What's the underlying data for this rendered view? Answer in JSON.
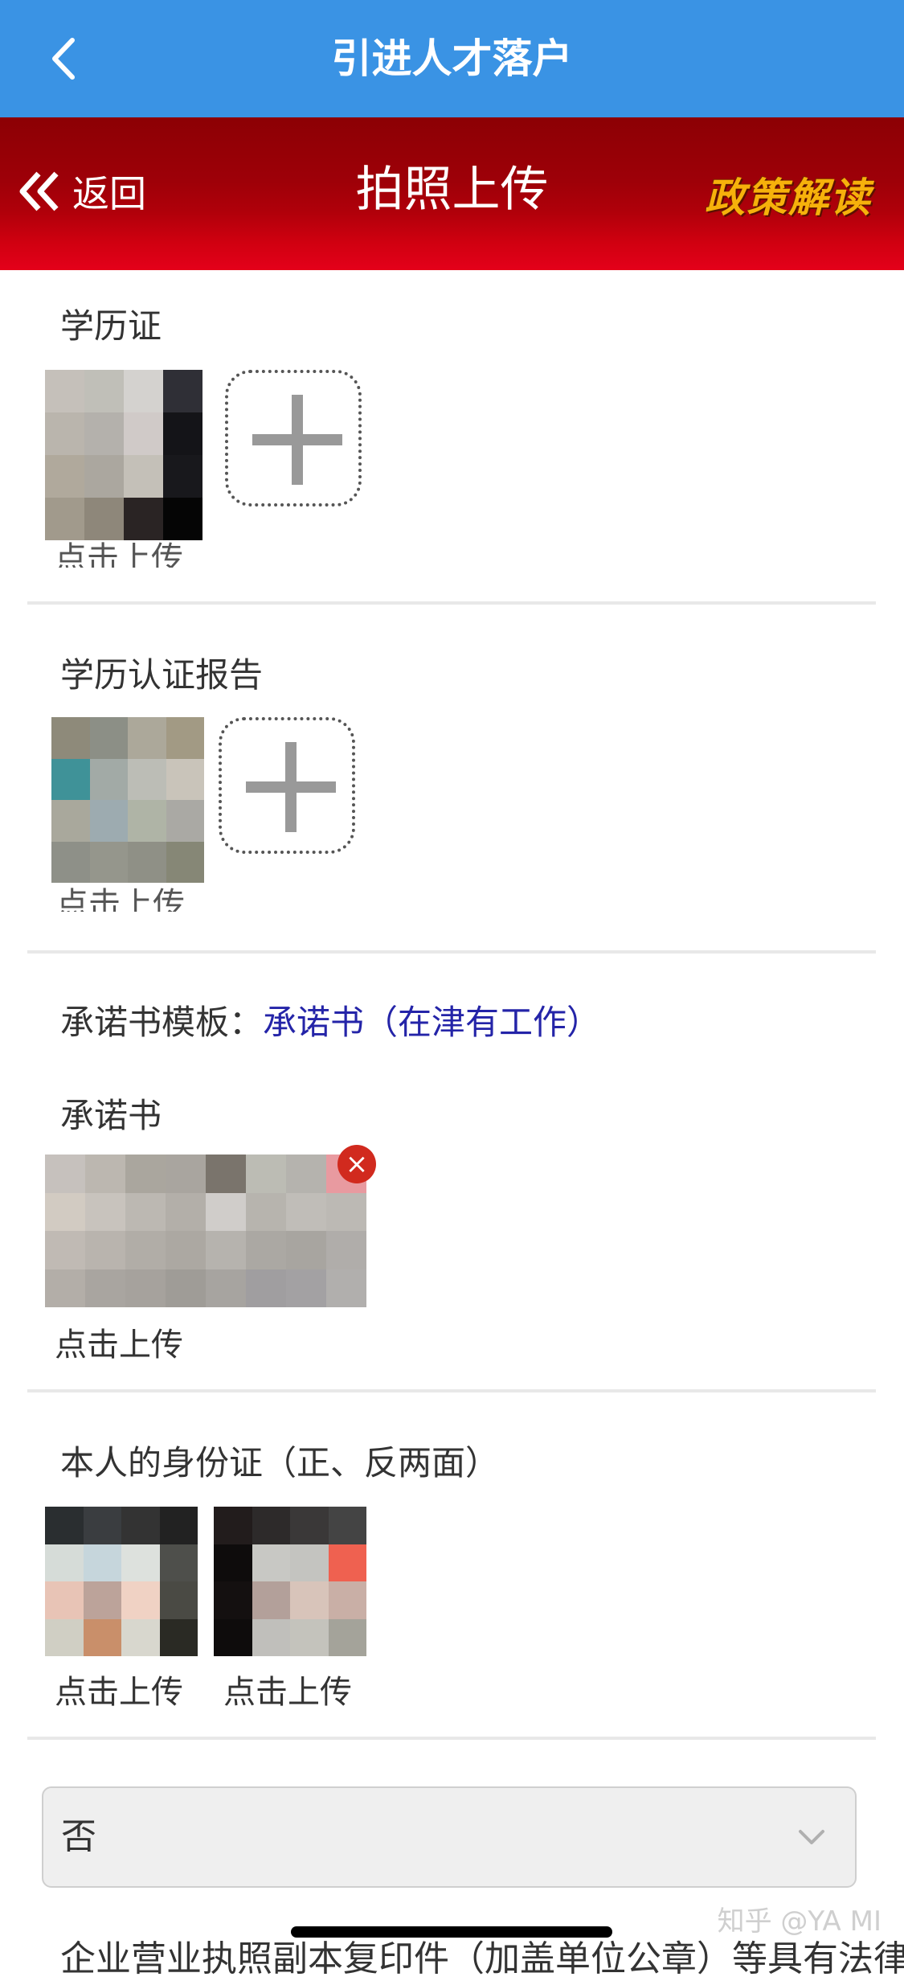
{
  "nav": {
    "title": "引进人才落户"
  },
  "header": {
    "back_label": "返回",
    "title": "拍照上传",
    "policy_label": "政策解读"
  },
  "sections": {
    "diploma": {
      "label": "学历证",
      "upload_label": "点击上传"
    },
    "degree_report": {
      "label": "学历认证报告",
      "upload_label": "点击上传"
    },
    "template": {
      "label": "承诺书模板：",
      "link": "承诺书（在津有工作）"
    },
    "commitment": {
      "label": "承诺书",
      "upload_label": "点击上传",
      "delete_mark": "×"
    },
    "id_card": {
      "label": "本人的身份证（正、反两面）",
      "upload_front": "点击上传",
      "upload_back": "点击上传"
    }
  },
  "select": {
    "value": "否"
  },
  "footer_text": "企业营业执照副本复印件（加盖单位公章）等具有法律",
  "watermark": "知乎 @YA MI",
  "colors": {
    "nav_blue": "#3a93e4",
    "header_red": "#c0000c",
    "policy_gold": "#f6b10b",
    "link_blue": "#2424a8"
  }
}
